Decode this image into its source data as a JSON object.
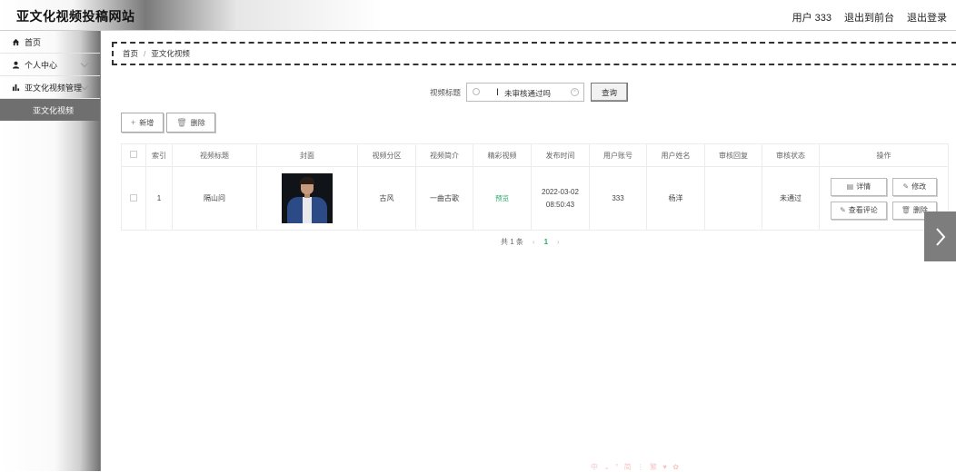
{
  "header": {
    "site_title": "亚文化视频投稿网站",
    "user": "用户 333",
    "back_to_front": "退出到前台",
    "logout": "退出登录"
  },
  "sidebar": {
    "items": [
      {
        "label": "首页",
        "icon": "home-icon"
      },
      {
        "label": "个人中心",
        "icon": "user-icon"
      },
      {
        "label": "亚文化视频管理",
        "icon": "bar-chart-icon"
      }
    ],
    "sub_items": [
      {
        "label": "亚文化视频"
      }
    ]
  },
  "breadcrumb": {
    "home": "首页",
    "separator": "/",
    "current": "亚文化视频"
  },
  "search": {
    "label": "视频标题",
    "value": "未审核通过吗",
    "query_button": "查询"
  },
  "actions": {
    "add": "新增",
    "delete": "删除"
  },
  "table": {
    "columns": [
      "索引",
      "视频标题",
      "封面",
      "视频分区",
      "视频简介",
      "精彩视频",
      "发布时间",
      "用户账号",
      "用户姓名",
      "审核回复",
      "审核状态",
      "操作"
    ],
    "rows": [
      {
        "index": "1",
        "title": "隔山问",
        "category": "古风",
        "intro": "一曲古歌",
        "video_link": "预览",
        "publish_time": "2022-03-02 08:50:43",
        "account": "333",
        "name": "杨洋",
        "review_reply": "",
        "review_status": "未通过",
        "ops": {
          "detail": "详情",
          "edit": "修改",
          "comments": "查看评论",
          "delete": "删除"
        }
      }
    ]
  },
  "pagination": {
    "total": "共 1 条",
    "current_page": "1"
  },
  "footer_mark": "中 ⌄ ° 简 ⋮ 繁 ♥ ✿",
  "colors": {
    "accent_green": "#2ea86b",
    "sidebar_active": "#6f6f6f",
    "arrow_panel": "#7d7d7d"
  }
}
